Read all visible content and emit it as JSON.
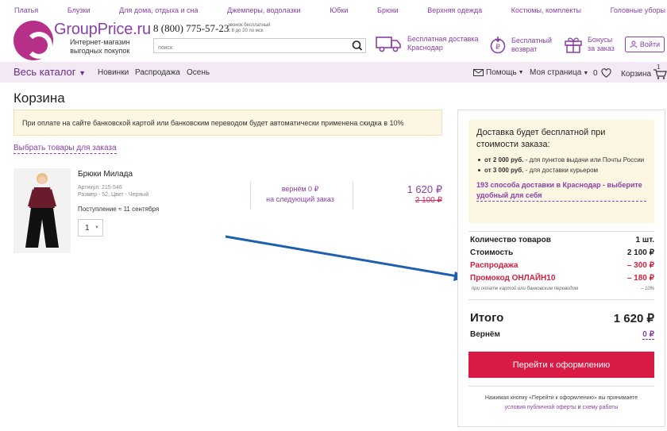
{
  "topnav": {
    "items": [
      "Платья",
      "Блузки",
      "Для дома, отдыха и сна",
      "Джемперы, водолазки",
      "Юбки",
      "Брюки",
      "Верхняя одежда",
      "Костюмы, комплекты",
      "Головные уборы"
    ]
  },
  "header": {
    "logo": {
      "title": "GroupPrice.ru",
      "sub1": "Интернет-магазин",
      "sub2": "выгодных покупок"
    },
    "phone": "8 (800) 775-57-23",
    "phone_note1": "звонок бесплатный",
    "phone_note2": "с 8 до 20 по мск",
    "search_placeholder": "поиск",
    "features": {
      "delivery1": "Бесплатная доставка",
      "delivery2": "Краснодар",
      "return1": "Бесплатный",
      "return2": "возврат",
      "bonus1": "Бонусы",
      "bonus2": "за заказ"
    },
    "login": "Войти"
  },
  "mainnav": {
    "catalog": "Весь каталог",
    "new": "Новинки",
    "sale": "Распродажа",
    "autumn": "Осень",
    "help": "Помощь",
    "mypage": "Моя страница",
    "fav_count": "0",
    "cart": "Корзина",
    "cart_count": "1"
  },
  "page": {
    "title": "Корзина",
    "notice": "При оплате на сайте банковской картой или банковским переводом будет автоматически применена скидка в 10%",
    "choose_link": "Выбрать товары для заказа"
  },
  "product": {
    "name": "Брюки Милада",
    "article": "Артикул: 215-546",
    "meta": "Размер - 52, Цвет - Черный",
    "arrival": "Поступление ≈ 11 сентября",
    "qty": "1",
    "cashback1": "вернём 0 ₽",
    "cashback2": "на следующий заказ",
    "price": "1 620 ₽",
    "price_old": "2 100 ₽"
  },
  "summary": {
    "delivery_title": "Доставка будет бесплатной при стоимости заказа:",
    "b1_amount": "от 2 000 руб.",
    "b1_text": " - для пунктов выдачи или Почты России",
    "b2_amount": "от 3 000 руб.",
    "b2_text": " - для доставки курьером",
    "delivery_link": "193 способа доставки в Краснодар - выберите удобный для себя",
    "count_label": "Количество товаров",
    "count_value": "1 шт.",
    "cost_label": "Стоимость",
    "cost_value": "2 100 ₽",
    "sale_label": "Распродажа",
    "sale_value": "– 300 ₽",
    "promo_label": "Промокод ОНЛАЙН10",
    "promo_value": "– 180 ₽",
    "card_note": "при оплате картой или банковским переводом",
    "card_note_value": "– 10%",
    "total_label": "Итого",
    "total_value": "1 620 ₽",
    "return_label": "Вернём",
    "return_value": "0 ₽",
    "checkout": "Перейти к оформлению",
    "legal1": "Нажимая кнопку «Перейти к оформлению» вы принимаете",
    "legal_link1": "условия публичной оферты",
    "legal_and": " и ",
    "legal_link2": "схему работы"
  },
  "colors": {
    "brand": "#8b3fa8",
    "accent": "#d91a45",
    "arrow": "#1f5fb0"
  }
}
